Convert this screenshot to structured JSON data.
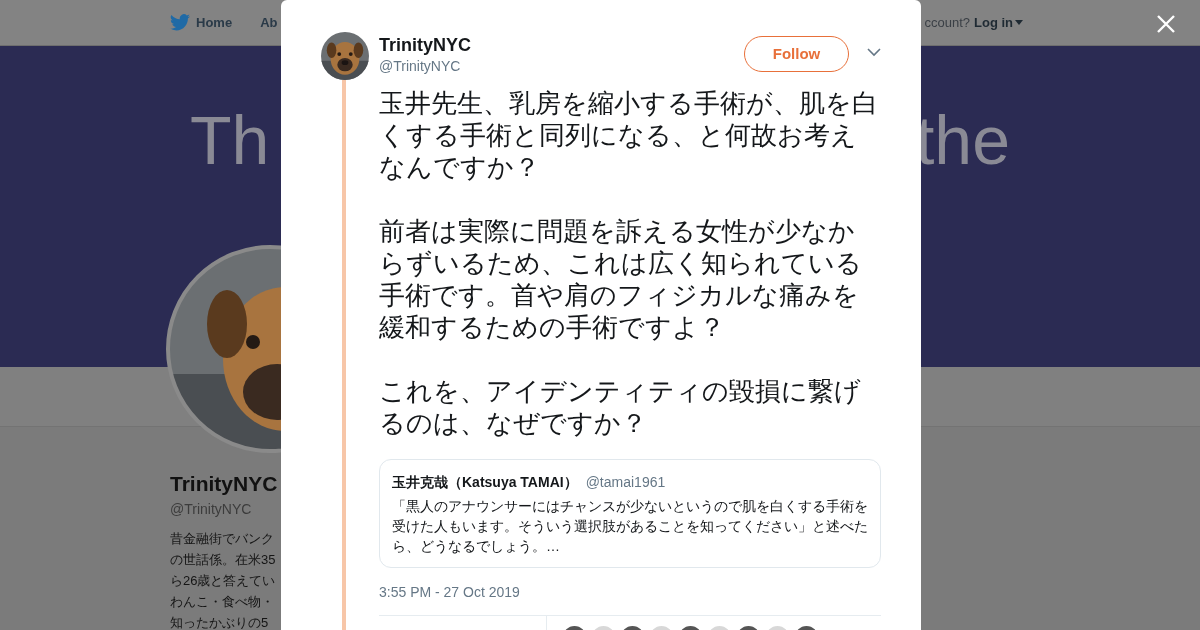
{
  "header": {
    "nav": [
      {
        "label": "Home"
      },
      {
        "label": "Ab"
      }
    ],
    "account_prompt": "ccount?",
    "login": "Log in"
  },
  "profile": {
    "banner_words": [
      "Th",
      "the"
    ],
    "name": "TrinityNYC",
    "handle": "@TrinityNYC",
    "bio_lines": [
      "昔金融街でバンク",
      "の世話係。在米35",
      "ら26歳と答えてい",
      "わんこ・食べ物・",
      "知ったかぶりの5"
    ]
  },
  "tweet": {
    "author": "TrinityNYC",
    "handle": "@TrinityNYC",
    "follow": "Follow",
    "paragraphs": [
      "玉井先生、乳房を縮小する手術が、肌を白くする手術と同列になる、と何故お考えなんですか？",
      "前者は実際に問題を訴える女性が少なからずいるため、これは広く知られている手術です。首や肩のフィジカルな痛みを緩和するための手術ですよ？",
      "これを、アイデンティティの毀損に繋げるのは、なぜですか？"
    ],
    "quote": {
      "author": "玉井克哉（Katsuya TAMAI）",
      "handle": "@tamai1961",
      "text": "「黒人のアナウンサーにはチャンスが少ないというので肌を白くする手術を受けた人もいます。そういう選択肢があることを知ってください」と述べたら、どうなるでしょう。…"
    },
    "time": "3:55 PM - 27 Oct 2019"
  }
}
